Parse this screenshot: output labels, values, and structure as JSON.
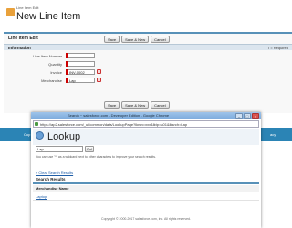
{
  "header": {
    "small_label": "Line Item Edit",
    "title": "New Line Item"
  },
  "form": {
    "record_title": "Line Item Edit",
    "buttons": [
      "Save",
      "Save & New",
      "Cancel"
    ],
    "section_title": "Information",
    "required_note": "I = Required",
    "fields": [
      {
        "label": "Line Item Number",
        "value": "",
        "required": true
      },
      {
        "label": "Quantity",
        "value": "",
        "required": true
      },
      {
        "label": "Invoice",
        "value": "INV-0002",
        "required": true,
        "lookup": true
      },
      {
        "label": "Merchandise",
        "value": "Lap",
        "required": true,
        "lookup": true
      }
    ]
  },
  "strip": {
    "left_text": "Cop",
    "right_text": "acy"
  },
  "popup": {
    "window_title": "Search ~ salesforce.com - Developer Edition - Google Chrome",
    "window_controls": [
      "–",
      "□",
      "×"
    ],
    "address": "https://ap2.salesforce.com/_ui/common/data/LookupPage?lknm=xxx&lktp=a01&lksrch=Lap",
    "lookup_title": "Lookup",
    "search_value": "Lap",
    "go_label": "Go!",
    "search_hint": "You can use \"*\" as a wildcard next to other characters to improve your search results.",
    "clear_link": "« Clear Search Results",
    "results_title": "Search Results",
    "results_columns": [
      "Merchandise Name"
    ],
    "results_rows": [
      [
        "Laptop"
      ]
    ],
    "copyright": "Copyright © 2000-2017 salesforce.com, inc. All rights reserved."
  },
  "colors": {
    "brand_blue": "#2b84b5",
    "section_bar": "#dbe5ee",
    "required_red": "#c00",
    "link": "#1f5ea8"
  }
}
